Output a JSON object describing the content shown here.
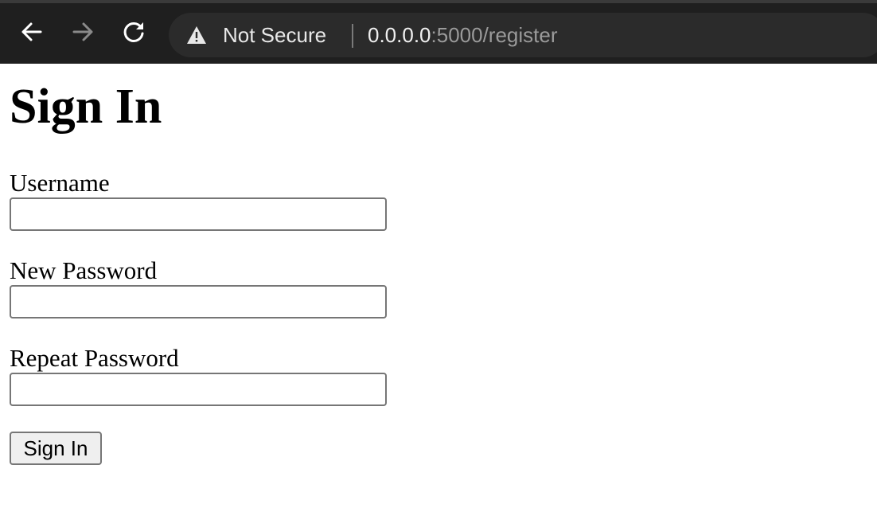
{
  "browser": {
    "security_label": "Not Secure",
    "url_host": "0.0.0.0",
    "url_rest": ":5000/register",
    "icons": {
      "back": "arrow-left-icon",
      "forward": "arrow-right-icon",
      "reload": "reload-icon",
      "security": "warning-triangle-icon"
    },
    "forward_enabled": false
  },
  "page": {
    "title": "Sign In",
    "form": {
      "username": {
        "label": "Username",
        "value": ""
      },
      "new_password": {
        "label": "New Password",
        "value": ""
      },
      "repeat_password": {
        "label": "Repeat Password",
        "value": ""
      },
      "submit_label": "Sign In"
    }
  },
  "colors": {
    "toolbar_bg": "#1f1f1f",
    "omnibox_bg": "#2b2b2b",
    "url_host": "#f0f0f0",
    "url_path": "#9a9a9a"
  }
}
